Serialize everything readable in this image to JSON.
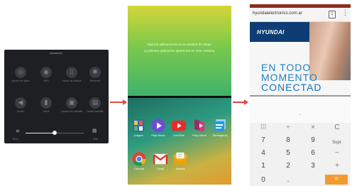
{
  "quick_settings": {
    "tiles": [
      {
        "icon": "data-saver-icon",
        "glyph": "◎",
        "label": "Ahorro de datos",
        "on": false
      },
      {
        "icon": "wifi-icon",
        "glyph": "◉",
        "label": "WiFi",
        "on": true
      },
      {
        "icon": "battery-saver-icon",
        "glyph": "▯",
        "label": "Ahorro de batería",
        "on": false
      },
      {
        "icon": "bluetooth-icon",
        "glyph": "✱",
        "label": "Bluetooth",
        "on": false
      },
      {
        "icon": "sound-icon",
        "glyph": "◀",
        "label": "Sonido",
        "on": true
      },
      {
        "icon": "vibrate-icon",
        "glyph": "▮",
        "label": "Vibrar",
        "on": true
      },
      {
        "icon": "screenshot-icon",
        "glyph": "▣",
        "label": "Captura de pantalla",
        "on": true
      },
      {
        "icon": "split-screen-icon",
        "glyph": "▤",
        "label": "Dividir pantalla",
        "on": false
      }
    ],
    "brightness": 0.5,
    "left_label": "Brillo",
    "right_label": "Más"
  },
  "split_screen": {
    "message_line1": "Elija las aplicaciones en la ventana de abajo.",
    "message_line2": "La primera aplicación aparecerá en esta ventana.",
    "apps": [
      {
        "name": "Juegos",
        "icon": "games-icon",
        "color": "#2f6db5"
      },
      {
        "name": "Play Music",
        "icon": "play-music-icon",
        "color": "#6f4bd8"
      },
      {
        "name": "YouTube",
        "icon": "youtube-icon",
        "color": "#e52d27"
      },
      {
        "name": "Play Libros",
        "icon": "play-books-icon",
        "color": "#d33a7c"
      },
      {
        "name": "Mensajería",
        "icon": "messaging-icon",
        "color": "#2a9bd8"
      },
      {
        "name": "Chrome",
        "icon": "chrome-icon",
        "color": "#db4437"
      },
      {
        "name": "Gmail",
        "icon": "gmail-icon",
        "color": "#d93025"
      },
      {
        "name": "Ajustes",
        "icon": "settings-icon",
        "color": "#f2b318"
      }
    ]
  },
  "browser": {
    "url": "hyundaielectronics.com.ar",
    "tabs_count": "1",
    "brand": "HYUNDAI",
    "headline_1": "EN TODO",
    "headline_2": "MOMENTO",
    "headline_3": "CONECTAD"
  },
  "calculator": {
    "rows": [
      [
        "⁞⁞⁞",
        "÷",
        "×",
        "C"
      ],
      [
        "7",
        "8",
        "9",
        "Supr."
      ],
      [
        "4",
        "5",
        "6",
        "−"
      ],
      [
        "1",
        "2",
        "3",
        "+"
      ],
      [
        "0",
        ".",
        "",
        "="
      ]
    ]
  },
  "colors": {
    "arrow": "#e0483e",
    "accent_orange": "#f39a2e",
    "brand_blue": "#0d3d74"
  }
}
